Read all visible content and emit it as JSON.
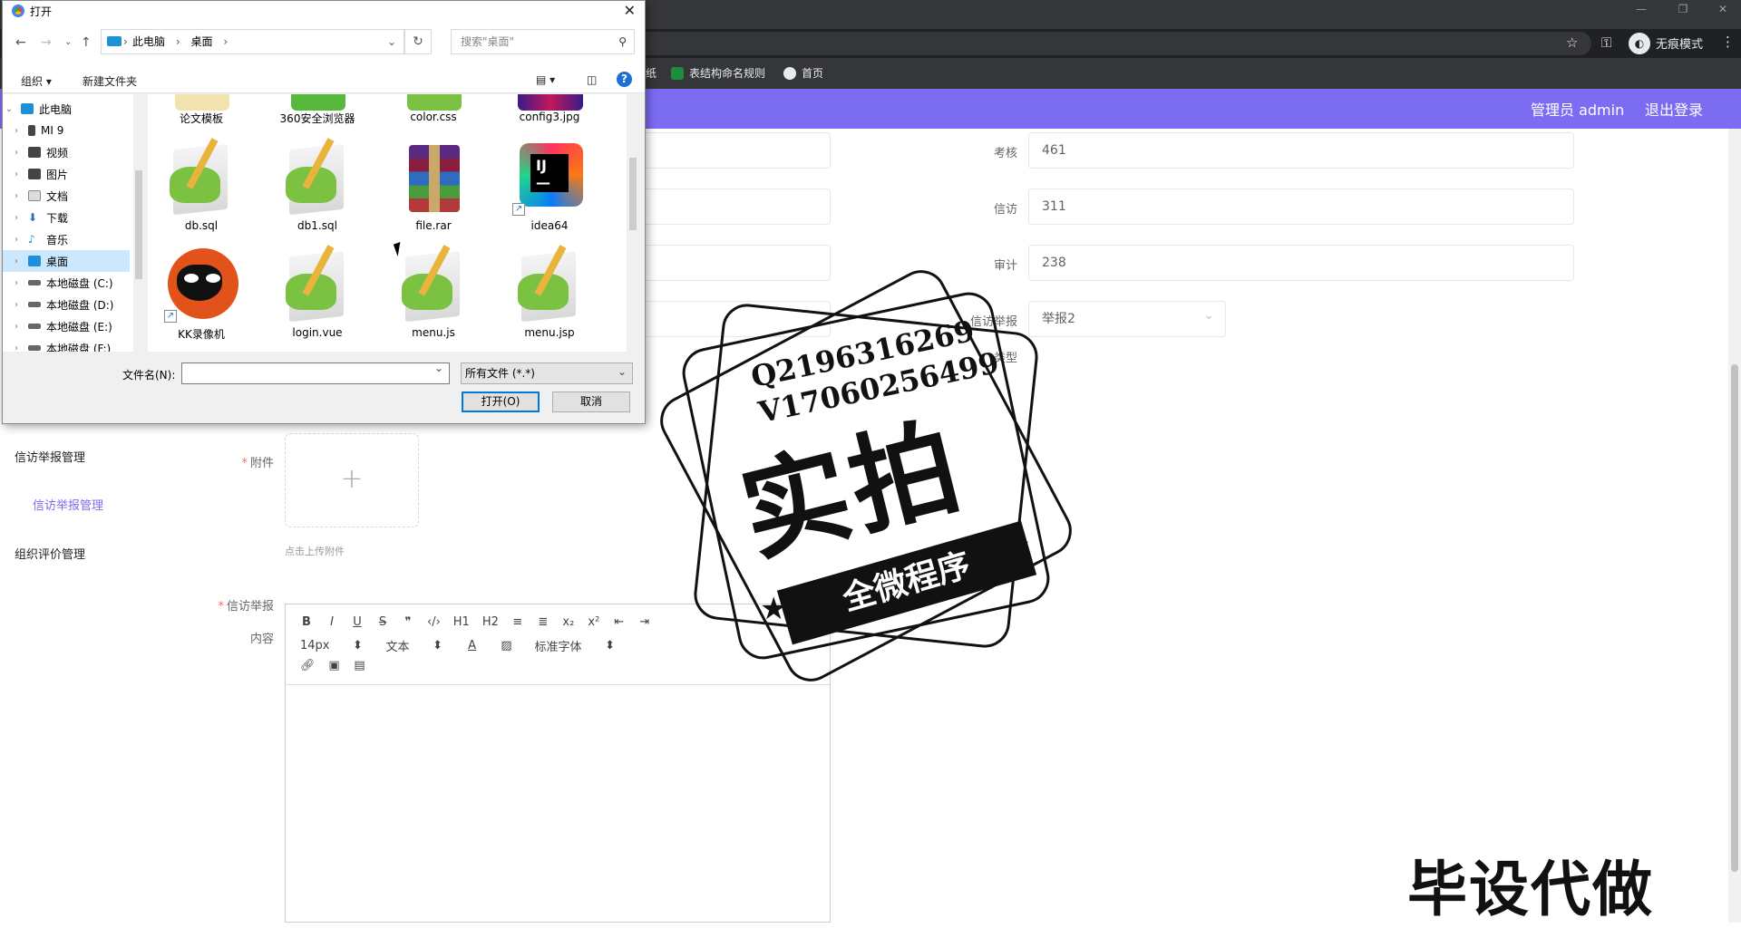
{
  "browser": {
    "incognito_label": "无痕模式",
    "bookmarks": [
      "纸",
      "表结构命名规则",
      "首页"
    ]
  },
  "app": {
    "admin_label": "管理员 admin",
    "logout_label": "退出登录"
  },
  "sidebar": {
    "items": [
      {
        "label": "信访举报管理"
      },
      {
        "label": "信访举报管理"
      },
      {
        "label": "组织评价管理"
      }
    ]
  },
  "form": {
    "fields": [
      {
        "label": "考核",
        "value": "461"
      },
      {
        "label": "信访",
        "value": "311"
      },
      {
        "label": "审计",
        "value": "238"
      },
      {
        "label": "信访举报",
        "value": "举报2"
      },
      {
        "label": "类型",
        "value": ""
      }
    ],
    "attachment_label": "附件",
    "upload_plus": "+",
    "upload_hint": "点击上传附件",
    "content_label_line1": "信访举报",
    "content_label_line2": "内容"
  },
  "editor_toolbar": {
    "row1": [
      "B",
      "I",
      "U",
      "S",
      "❞",
      "‹/›",
      "H1",
      "H2",
      "≡",
      "≣",
      "x₂",
      "x²",
      "⇤",
      "⇥"
    ],
    "font_size": "14px",
    "text_type": "文本",
    "font_family": "标准字体",
    "row3_icons": [
      "link-icon",
      "image-icon",
      "video-icon"
    ]
  },
  "dialog": {
    "title": "打开",
    "breadcrumb": [
      "此电脑",
      "桌面"
    ],
    "search_placeholder": "搜索\"桌面\"",
    "organize_label": "组织 ▾",
    "new_folder_label": "新建文件夹",
    "tree": [
      {
        "label": "此电脑",
        "icon_color": "#1e90d8"
      },
      {
        "label": "MI 9",
        "icon_color": "#444444"
      },
      {
        "label": "视频",
        "icon_color": "#444444"
      },
      {
        "label": "图片",
        "icon_color": "#444444"
      },
      {
        "label": "文档",
        "icon_color": "#888888"
      },
      {
        "label": "下载",
        "icon_color": "#1e6fd0"
      },
      {
        "label": "音乐",
        "icon_color": "#1e90d8"
      },
      {
        "label": "桌面",
        "icon_color": "#1e90d8"
      },
      {
        "label": "本地磁盘 (C:)",
        "icon_color": "#666666"
      },
      {
        "label": "本地磁盘 (D:)",
        "icon_color": "#666666"
      },
      {
        "label": "本地磁盘 (E:)",
        "icon_color": "#666666"
      },
      {
        "label": "本地磁盘 (F:)",
        "icon_color": "#666666"
      }
    ],
    "files_row0": [
      "论文模板",
      "360安全浏览器",
      "color.css",
      "config3.jpg"
    ],
    "files_row1": [
      "db.sql",
      "db1.sql",
      "file.rar",
      "idea64"
    ],
    "files_row2": [
      "KK录像机",
      "login.vue",
      "menu.js",
      "menu.jsp"
    ],
    "filename_label": "文件名(N):",
    "filename_value": "",
    "filetype_value": "所有文件 (*.*)",
    "open_button": "打开(O)",
    "cancel_button": "取消"
  },
  "watermark": {
    "line1": "Q2196316269",
    "line2": "V17060256499",
    "big": "实拍",
    "ribbon": "全微程序",
    "bottom_right": "毕设代做"
  },
  "colors": {
    "accent": "#7c6cf2",
    "required": "#f56c6c"
  }
}
